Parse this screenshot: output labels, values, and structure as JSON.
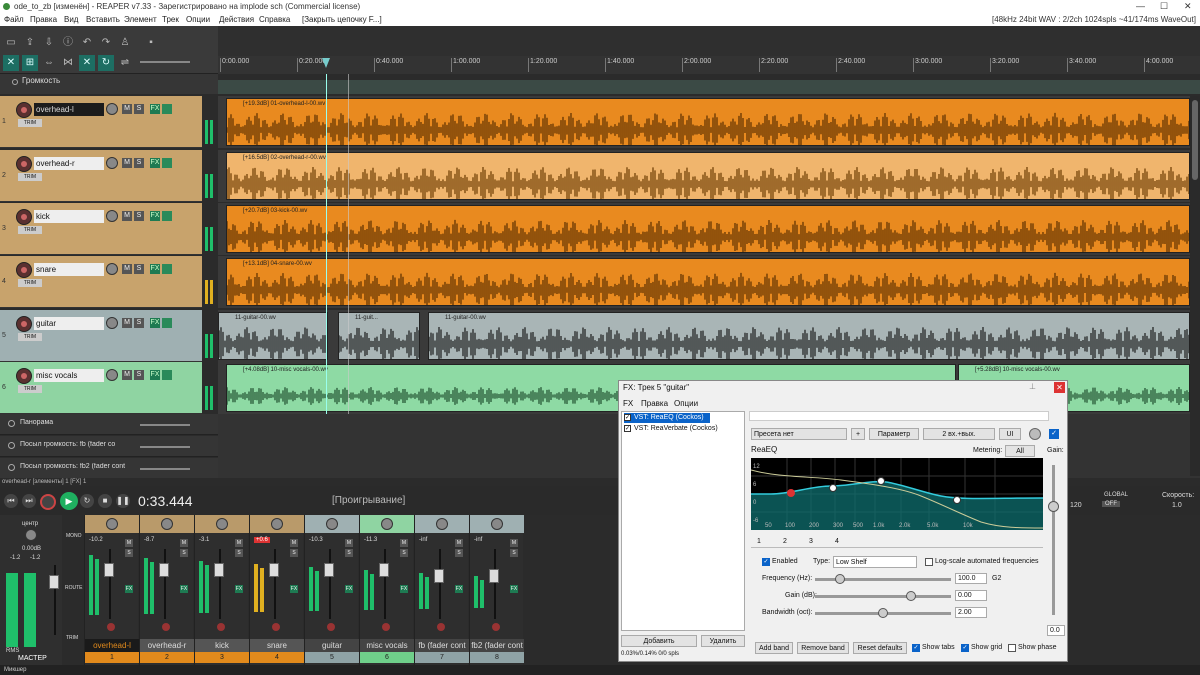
{
  "titlebar": {
    "title": "ode_to_zb [изменён] - REAPER v7.33 - Зарегистрировано на implode sch (Commercial license)"
  },
  "menu": {
    "items": [
      "Файл",
      "Правка",
      "Вид",
      "Вставить",
      "Элемент",
      "Трек",
      "Опции",
      "Действия",
      "Справка"
    ],
    "item_extra": "[Закрыть цепочку F...]",
    "right_info": "[48kHz 24bit WAV : 2/2ch 1024spls ~41/174ms WaveOut]"
  },
  "ruler": {
    "labels": [
      "0:00.000",
      "0:20.000",
      "0:40.000",
      "1:00.000",
      "1:20.000",
      "1:40.000",
      "2:00.000",
      "2:20.000",
      "2:40.000",
      "3:00.000",
      "3:20.000",
      "3:40.000",
      "4:00.000"
    ]
  },
  "env_top": {
    "label": "Громкость"
  },
  "tracks": [
    {
      "num": "1",
      "name": "overhead-l",
      "item": "[+19.3dB] 01-overhead-l-00.wv"
    },
    {
      "num": "2",
      "name": "overhead-r",
      "item": "[+16.5dB] 02-overhead-r-00.wv"
    },
    {
      "num": "3",
      "name": "kick",
      "item": "[+20.7dB] 03-kick-00.wv"
    },
    {
      "num": "4",
      "name": "snare",
      "item": "[+13.1dB] 04-snare-00.wv"
    },
    {
      "num": "5",
      "name": "guitar",
      "items": [
        "11-guitar-00.wv",
        "11-guit...",
        "11-guitar-00.wv"
      ]
    },
    {
      "num": "6",
      "name": "misc vocals",
      "items": [
        "[+4.08dB] 10-misc vocals-00.wv",
        "[+5.28dB] 10-misc vocals-00.wv"
      ]
    }
  ],
  "buttons": {
    "mute": "M",
    "solo": "S",
    "fx": "FX",
    "trim": "TRIM"
  },
  "env_rows": [
    "Панорама",
    "Посыл громкость: fb (fader co",
    "Посыл громкость: fb2 (fader cont"
  ],
  "statusline": "overhead-r [элементы] 1 [FX] 1",
  "transport": {
    "time": "0:33.444",
    "state": "[Проигрывание]"
  },
  "master": {
    "label": "МАСТЕР",
    "center": "центр",
    "db": "0.00dB",
    "l": "-1.2",
    "r": "-1.2",
    "rms": "RMS"
  },
  "strip_side": [
    "MONO",
    "ROUTE",
    "TRIM"
  ],
  "strips": [
    {
      "name": "overhead-l",
      "num": "1",
      "db": "-10.2",
      "color": "#e28a1c"
    },
    {
      "name": "overhead-r",
      "num": "2",
      "db": "-8.7",
      "color": "#e28a1c"
    },
    {
      "name": "kick",
      "num": "3",
      "db": "-3.1",
      "color": "#e28a1c"
    },
    {
      "name": "snare",
      "num": "4",
      "db": "+0.6",
      "color": "#e28a1c"
    },
    {
      "name": "guitar",
      "num": "5",
      "db": "-10.3",
      "color": "#8fa3a6"
    },
    {
      "name": "misc vocals",
      "num": "6",
      "db": "-11.3",
      "color": "#6fcf8a"
    },
    {
      "name": "fb (fader cont",
      "num": "7",
      "db": "-inf",
      "color": "#8fa3a6"
    },
    {
      "name": "fb2 (fader cont",
      "num": "8",
      "db": "-inf",
      "color": "#8fa3a6"
    }
  ],
  "fx": {
    "title": "FX: Трек 5 \"guitar\"",
    "menu": [
      "FX",
      "Правка",
      "Опции"
    ],
    "list": [
      "VST: ReaEQ (Cockos)",
      "VST: ReaVerbate (Cockos)"
    ],
    "add": "Добавить",
    "remove": "Удалить",
    "cpu": "0.03%/0.14% 0/0 spls",
    "preset": "Пресета нет",
    "plus": "+",
    "param": "Параметр",
    "io": "2 вх.+вых.",
    "ui": "UI",
    "plugin": "ReaEQ",
    "metering": "Metering:",
    "metering_val": "All",
    "gain": "Gain:",
    "tabs": [
      "1",
      "2",
      "3",
      "4"
    ],
    "enabled": "Enabled",
    "type_label": "Type:",
    "type_val": "Low Shelf",
    "logscale": "Log-scale automated frequencies",
    "freq_label": "Frequency (Hz):",
    "freq_val": "100.0",
    "freq_note": "G2",
    "gain_label": "Gain (dB):",
    "gain_val": "0.00",
    "bw_label": "Bandwidth (oct):",
    "bw_val": "2.00",
    "gain_out": "0.0",
    "add_band": "Add band",
    "remove_band": "Remove band",
    "reset": "Reset defaults",
    "show_tabs": "Show tabs",
    "show_grid": "Show grid",
    "show_phase": "Show phase",
    "x_labels": [
      "50",
      "100",
      "200",
      "300",
      "500",
      "1.0k",
      "2.0k",
      "5.0k",
      "10k"
    ],
    "y_labels": [
      "12",
      "6",
      "0",
      "-6"
    ]
  },
  "right_panel": {
    "global": "GLOBAL",
    "off": "OFF",
    "speed_label": "Скорость:",
    "speed_val": "1.0",
    "num": "120"
  },
  "footer": "Микшер",
  "colors": {
    "accent": "#1d6e63",
    "drums": "#e28a1c",
    "guitar": "#b8c5c7",
    "vocals": "#6fcf8a",
    "track_drum_bg": "#c9a66e"
  }
}
